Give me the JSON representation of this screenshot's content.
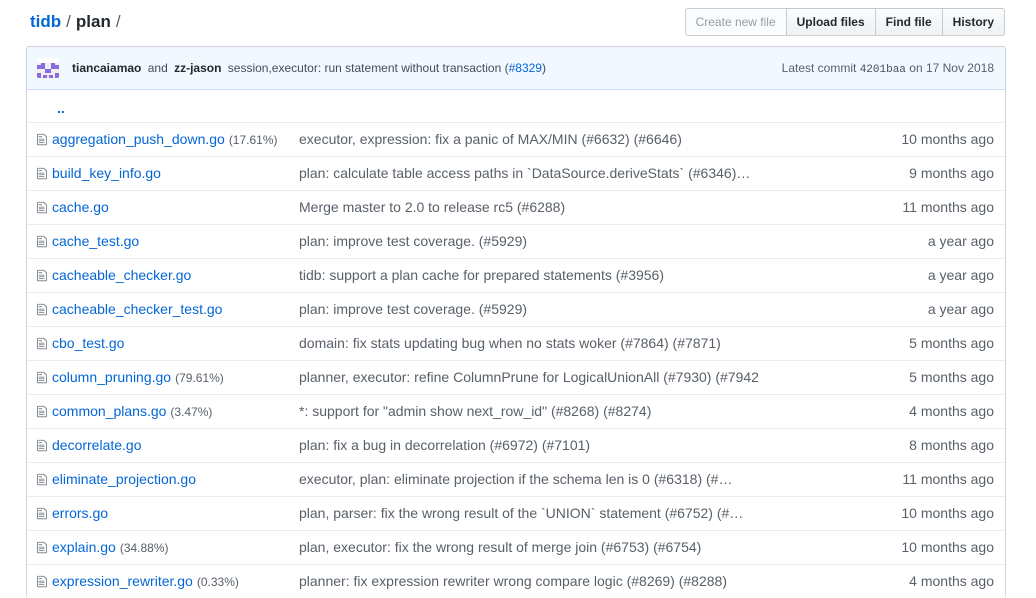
{
  "breadcrumb": {
    "repo": "tidb",
    "separator": "/",
    "dir": "plan",
    "trailing": "/"
  },
  "buttons": {
    "create_new_file": "Create new file",
    "upload_files": "Upload files",
    "find_file": "Find file",
    "history": "History"
  },
  "commit": {
    "author1": "tiancaiamao",
    "and": "and",
    "author2": "zz-jason",
    "message": "session,executor: run statement without transaction (",
    "pr": "#8329",
    "message_end": ")",
    "latest_label": "Latest commit",
    "sha": "4201baa",
    "date": "on 17 Nov 2018"
  },
  "updir": "..",
  "files": [
    {
      "name": "aggregation_push_down.go",
      "coverage": "(17.61%)",
      "message": "executor, expression: fix a panic of MAX/MIN (#6632) (#6646)",
      "age": "10 months ago"
    },
    {
      "name": "build_key_info.go",
      "coverage": "",
      "message": "plan: calculate table access paths in `DataSource.deriveStats` (#6346)…",
      "age": "9 months ago"
    },
    {
      "name": "cache.go",
      "coverage": "",
      "message": "Merge master to 2.0 to release rc5 (#6288)",
      "age": "11 months ago"
    },
    {
      "name": "cache_test.go",
      "coverage": "",
      "message": "plan: improve test coverage. (#5929)",
      "age": "a year ago"
    },
    {
      "name": "cacheable_checker.go",
      "coverage": "",
      "message": "tidb: support a plan cache for prepared statements (#3956)",
      "age": "a year ago"
    },
    {
      "name": "cacheable_checker_test.go",
      "coverage": "",
      "message": "plan: improve test coverage. (#5929)",
      "age": "a year ago"
    },
    {
      "name": "cbo_test.go",
      "coverage": "",
      "message": "domain: fix stats updating bug when no stats woker (#7864) (#7871)",
      "age": "5 months ago"
    },
    {
      "name": "column_pruning.go",
      "coverage": "(79.61%)",
      "message": "planner, executor: refine ColumnPrune for LogicalUnionAll (#7930) (#7942",
      "age": "5 months ago"
    },
    {
      "name": "common_plans.go",
      "coverage": "(3.47%)",
      "message": "*: support for \"admin show next_row_id\" (#8268) (#8274)",
      "age": "4 months ago"
    },
    {
      "name": "decorrelate.go",
      "coverage": "",
      "message": "plan: fix a bug in decorrelation (#6972) (#7101)",
      "age": "8 months ago"
    },
    {
      "name": "eliminate_projection.go",
      "coverage": "",
      "message": "executor, plan: eliminate projection if the schema len is 0 (#6318) (#…",
      "age": "11 months ago"
    },
    {
      "name": "errors.go",
      "coverage": "",
      "message": "plan, parser: fix the wrong result of the `UNION` statement (#6752) (#…",
      "age": "10 months ago"
    },
    {
      "name": "explain.go",
      "coverage": "(34.88%)",
      "message": "plan, executor: fix the wrong result of merge join (#6753) (#6754)",
      "age": "10 months ago"
    },
    {
      "name": "expression_rewriter.go",
      "coverage": "(0.33%)",
      "message": "planner: fix expression rewriter wrong compare logic (#8269) (#8288)",
      "age": "4 months ago"
    }
  ]
}
